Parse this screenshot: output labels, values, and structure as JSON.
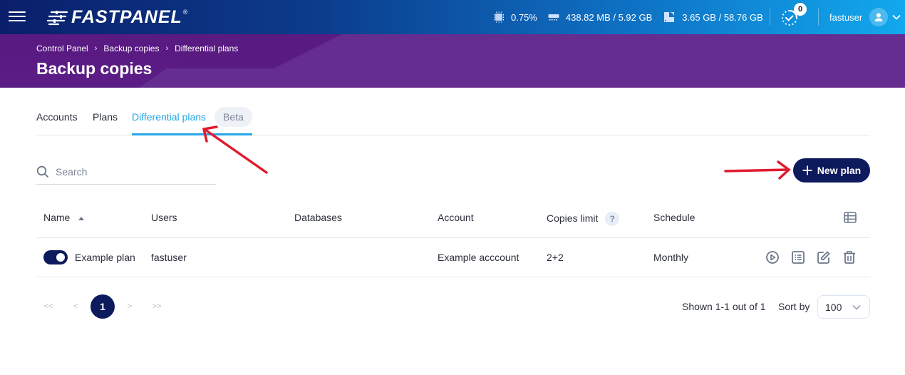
{
  "app": {
    "brand": "FASTPANEL",
    "brand_mark": "®"
  },
  "topbar": {
    "cpu": "0.75%",
    "ram": "438.82 MB / 5.92 GB",
    "disk": "3.65 GB / 58.76 GB",
    "tasks_count": "0",
    "username": "fastuser"
  },
  "breadcrumb": [
    "Control Panel",
    "Backup copies",
    "Differential plans"
  ],
  "page_title": "Backup copies",
  "tabs": [
    {
      "label": "Accounts",
      "active": false
    },
    {
      "label": "Plans",
      "active": false
    },
    {
      "label": "Differential plans",
      "active": true,
      "badge": "Beta"
    }
  ],
  "search": {
    "placeholder": "Search",
    "value": ""
  },
  "new_plan_label": "New plan",
  "table": {
    "columns": [
      "Name",
      "Users",
      "Databases",
      "Account",
      "Copies limit",
      "Schedule"
    ],
    "sorted_by": "Name",
    "sort_direction": "ascending",
    "help_icon": "?",
    "rows": [
      {
        "enabled": true,
        "name": "Example plan",
        "users": "fastuser",
        "databases": "",
        "account": "Example acccount",
        "copies_limit": "2+2",
        "schedule": "Monthly"
      }
    ]
  },
  "pagination": {
    "first": "<<",
    "prev": "<",
    "current": "1",
    "next": ">",
    "last": ">>",
    "shown": "Shown 1-1 out of 1",
    "sort_by_label": "Sort by",
    "per_page": "100"
  },
  "colors": {
    "accent": "#23a6e6",
    "primary": "#0d1a5c",
    "banner": "#652d90",
    "annotation_arrow": "#e01b2f"
  }
}
